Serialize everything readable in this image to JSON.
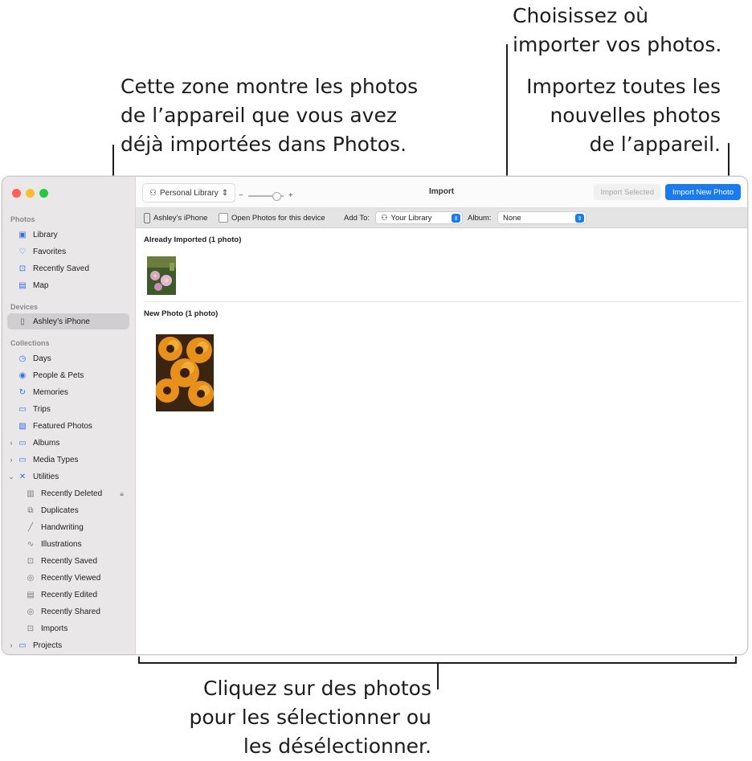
{
  "callouts": {
    "left": [
      "Cette zone montre les photos",
      "de l’appareil que vous avez",
      "déjà importées dans Photos."
    ],
    "top": [
      "Choisissez où",
      "importer vos photos."
    ],
    "right": [
      "Importez toutes les",
      "nouvelles photos",
      "de l’appareil."
    ],
    "bottom": [
      "Cliquez sur des photos",
      "pour les sélectionner ou",
      "les désélectionner."
    ]
  },
  "sidebar": {
    "sections": {
      "photos": "Photos",
      "devices": "Devices",
      "collections": "Collections"
    },
    "photos_items": [
      {
        "label": "Library",
        "icon": "library-icon"
      },
      {
        "label": "Favorites",
        "icon": "heart-icon"
      },
      {
        "label": "Recently Saved",
        "icon": "tray-icon"
      },
      {
        "label": "Map",
        "icon": "map-icon"
      }
    ],
    "device": "Ashley’s iPhone",
    "collections_items": [
      {
        "label": "Days",
        "icon": "clock-icon"
      },
      {
        "label": "People & Pets",
        "icon": "person-circle-icon"
      },
      {
        "label": "Memories",
        "icon": "memories-icon"
      },
      {
        "label": "Trips",
        "icon": "suitcase-icon"
      },
      {
        "label": "Featured Photos",
        "icon": "featured-photo-icon"
      },
      {
        "label": "Albums",
        "icon": "album-icon"
      },
      {
        "label": "Media Types",
        "icon": "album-icon"
      },
      {
        "label": "Utilities",
        "icon": "tools-icon"
      },
      {
        "label": "Recently Deleted",
        "icon": "trash-icon"
      },
      {
        "label": "Duplicates",
        "icon": "duplicate-icon"
      },
      {
        "label": "Handwriting",
        "icon": "pen-icon"
      },
      {
        "label": "Illustrations",
        "icon": "brush-icon"
      },
      {
        "label": "Recently Saved",
        "icon": "tray-icon"
      },
      {
        "label": "Recently Viewed",
        "icon": "eye-icon"
      },
      {
        "label": "Recently Edited",
        "icon": "edit-doc-icon"
      },
      {
        "label": "Recently Shared",
        "icon": "share-icon"
      },
      {
        "label": "Imports",
        "icon": "tray-icon"
      },
      {
        "label": "Projects",
        "icon": "album-icon"
      }
    ]
  },
  "toolbar": {
    "library_label": "Personal Library",
    "zoom_minus": "−",
    "zoom_plus": "+",
    "title": "Import",
    "import_selected": "Import Selected",
    "import_new": "Import New Photo"
  },
  "importbar": {
    "device": "Ashley’s iPhone",
    "open_photos": "Open Photos for this device",
    "add_to_label": "Add To:",
    "add_to_value": "Your Library",
    "album_label": "Album:",
    "album_value": "None"
  },
  "content": {
    "already_imported": "Already Imported (1 photo)",
    "new_photo": "New Photo (1 photo)"
  },
  "colors": {
    "accent": "#1a7bf0",
    "sidebar_bg": "#e9e7e8",
    "close": "#ff5f57",
    "minimize": "#febc2e",
    "zoom": "#28c840"
  }
}
